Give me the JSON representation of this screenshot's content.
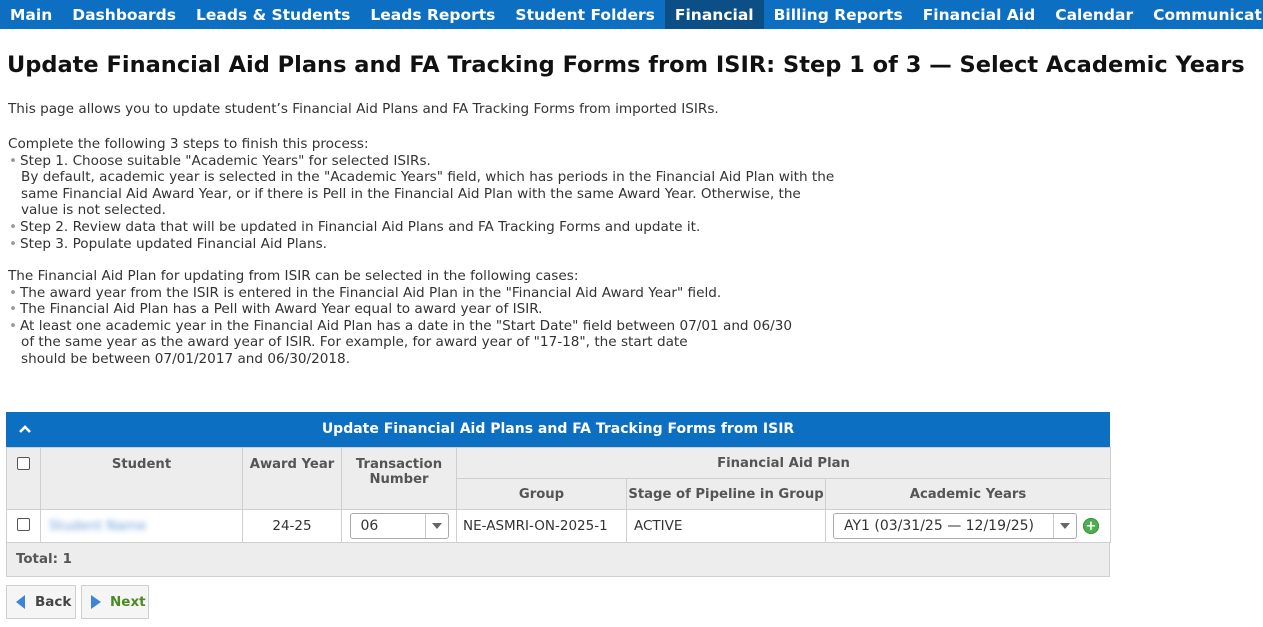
{
  "nav": {
    "items": [
      "Main",
      "Dashboards",
      "Leads & Students",
      "Leads Reports",
      "Student Folders",
      "Financial",
      "Billing Reports",
      "Financial Aid",
      "Calendar",
      "Communication"
    ],
    "active_index": 5
  },
  "page": {
    "title": "Update Financial Aid Plans and FA Tracking Forms from ISIR: Step 1 of 3 — Select Academic Years",
    "intro": "This page allows you to update student’s Financial Aid Plans and FA Tracking Forms from imported ISIRs.",
    "steps_heading": "Complete the following 3 steps to finish this process:",
    "step1": "Step 1. Choose suitable \"Academic Years\" for selected ISIRs.",
    "step1_detail_1": "By default, academic year is selected in the \"Academic Years\" field, which has periods in the Financial Aid Plan with the",
    "step1_detail_2": "same Financial Aid Award Year, or if there is Pell in the Financial Aid Plan with the same Award Year. Otherwise, the",
    "step1_detail_3": "value is not selected.",
    "step2": "Step 2. Review data that will be updated in Financial Aid Plans and FA Tracking Forms and update it.",
    "step3": "Step 3. Populate updated Financial Aid Plans.",
    "cases_heading": "The Financial Aid Plan for updating from ISIR can be selected in the following cases:",
    "case1": "The award year from the ISIR is entered in the Financial Aid Plan in the \"Financial Aid Award Year\" field.",
    "case2": "The Financial Aid Plan has a Pell with Award Year equal to award year of ISIR.",
    "case3_1": "At least one academic year in the Financial Aid Plan has a date in the \"Start Date\" field between 07/01 and 06/30",
    "case3_2": "of the same year as the award year of ISIR. For example, for award year of \"17-18\", the start date",
    "case3_3": "should be between 07/01/2017 and 06/30/2018."
  },
  "panel": {
    "title": "Update Financial Aid Plans and FA Tracking Forms from ISIR",
    "columns": {
      "student": "Student",
      "award_year": "Award Year",
      "transaction_number": "Transaction Number",
      "financial_aid_plan": "Financial Aid Plan",
      "group": "Group",
      "stage": "Stage of Pipeline in Group",
      "academic_years": "Academic Years"
    },
    "rows": [
      {
        "student": "Student Name",
        "award_year": "24-25",
        "transaction_number": "06",
        "group": "NE-ASMRI-ON-2025-1",
        "stage": "ACTIVE",
        "academic_year": "AY1 (03/31/25 — 12/19/25)"
      }
    ],
    "total": "Total: 1"
  },
  "buttons": {
    "back": "Back",
    "next": "Next"
  },
  "colors": {
    "nav_bg": "#0d6fc1",
    "nav_active": "#0b4f86",
    "header_bg": "#ededed",
    "next_text": "#4a8a20",
    "add_icon": "#4caf50"
  }
}
